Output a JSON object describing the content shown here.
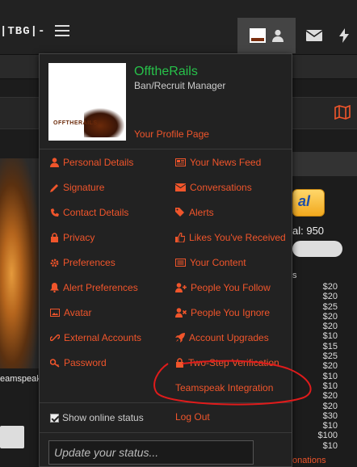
{
  "nav": {
    "site_title": "|TBG|-"
  },
  "user": {
    "name": "OfftheRails",
    "title": "Ban/Recruit Manager",
    "avatar_text": "OFFTHERAILS",
    "profile_link": "Your Profile Page"
  },
  "menu_left": [
    {
      "label": "Personal Details",
      "icon": "user-icon"
    },
    {
      "label": "Signature",
      "icon": "pen-icon"
    },
    {
      "label": "Contact Details",
      "icon": "phone-icon"
    },
    {
      "label": "Privacy",
      "icon": "lock-icon"
    },
    {
      "label": "Preferences",
      "icon": "gear-icon"
    },
    {
      "label": "Alert Preferences",
      "icon": "bell-icon"
    },
    {
      "label": "Avatar",
      "icon": "image-icon"
    },
    {
      "label": "External Accounts",
      "icon": "link-icon"
    },
    {
      "label": "Password",
      "icon": "key-icon"
    }
  ],
  "menu_right": [
    {
      "label": "Your News Feed",
      "icon": "newspaper-icon"
    },
    {
      "label": "Conversations",
      "icon": "envelope-icon"
    },
    {
      "label": "Alerts",
      "icon": "tags-icon"
    },
    {
      "label": "Likes You've Received",
      "icon": "thumbs-up-icon"
    },
    {
      "label": "Your Content",
      "icon": "list-icon"
    },
    {
      "label": "People You Follow",
      "icon": "user-plus-icon"
    },
    {
      "label": "People You Ignore",
      "icon": "user-times-icon"
    },
    {
      "label": "Account Upgrades",
      "icon": "rocket-icon"
    },
    {
      "label": "Two-Step Verification",
      "icon": "lock-icon"
    },
    {
      "label": "Teamspeak Integration",
      "icon": ""
    }
  ],
  "footer": {
    "show_online_label": "Show online status",
    "show_online_checked": true,
    "logout": "Log Out",
    "status_placeholder": "Update your status..."
  },
  "background": {
    "left_text": "eamspeak",
    "paypal_text": "al",
    "total_text": "al: 950",
    "donor_header": "s",
    "amounts": [
      "$20",
      "$20",
      "$25",
      "$20",
      "$20",
      "$10",
      "$15",
      "$25",
      "$20",
      "$10",
      "$10",
      "$20",
      "$20",
      "$30",
      "$10",
      "$100",
      "$10"
    ],
    "donations_link": "onations"
  },
  "colors": {
    "accent": "#f0552b",
    "username": "#27c14a",
    "annotation": "#e01b1b"
  }
}
